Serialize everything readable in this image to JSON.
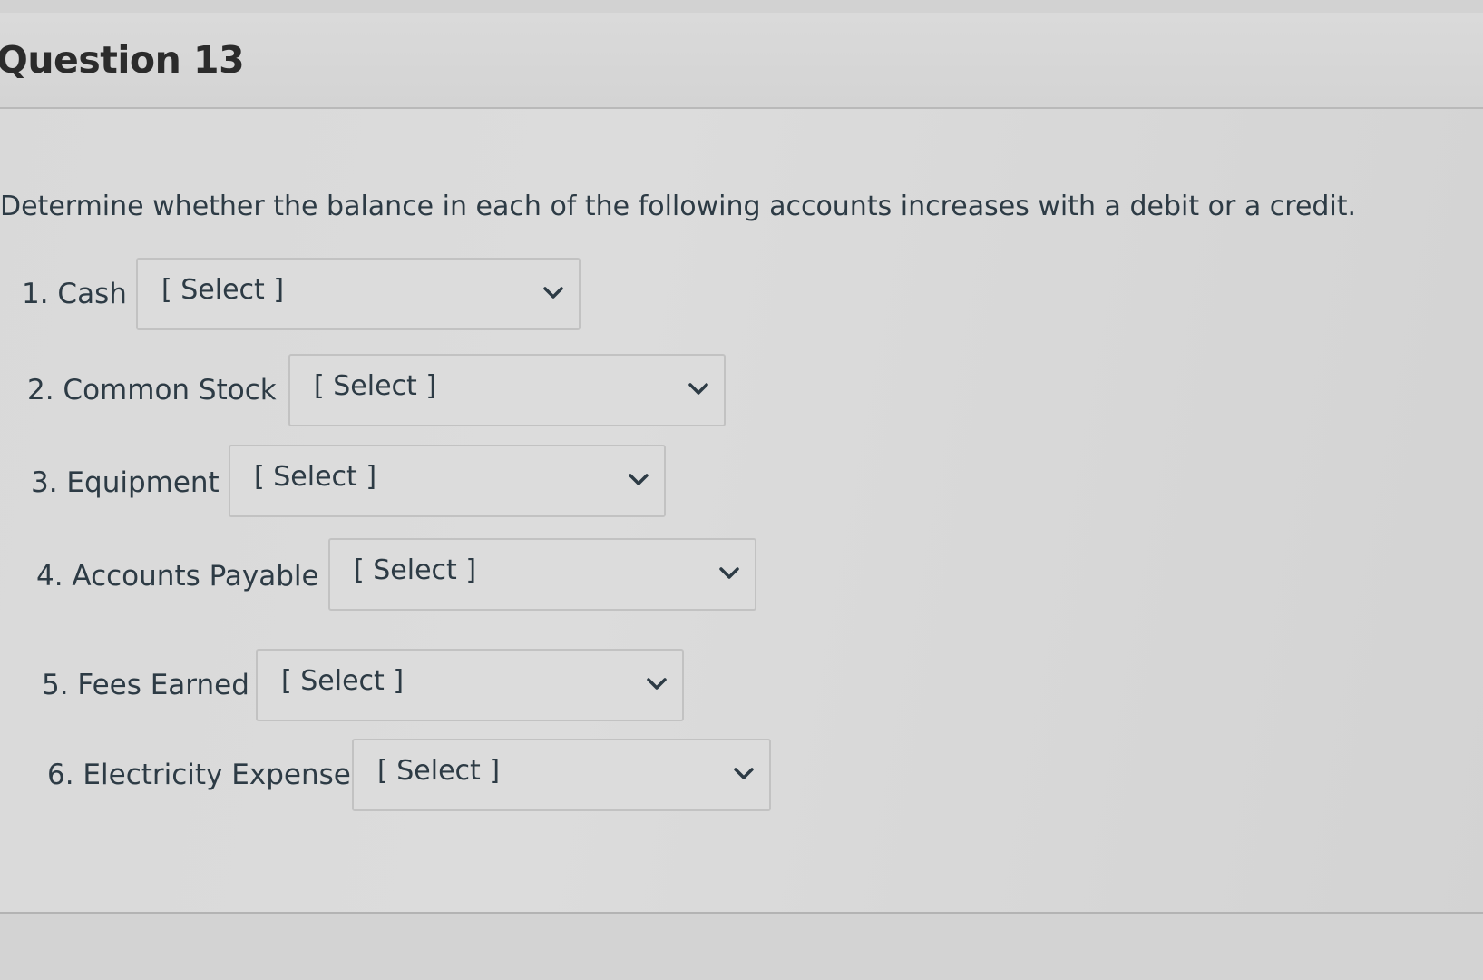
{
  "question": {
    "title": "Question 13",
    "prompt": "Determine whether the balance in each of the following accounts increases with a debit or a credit."
  },
  "items": [
    {
      "label": "1. Cash",
      "selected": "[ Select ]"
    },
    {
      "label": "2. Common Stock",
      "selected": "[ Select ]"
    },
    {
      "label": "3. Equipment",
      "selected": "[ Select ]"
    },
    {
      "label": "4. Accounts Payable",
      "selected": "[ Select ]"
    },
    {
      "label": "5. Fees Earned",
      "selected": "[ Select ]"
    },
    {
      "label": "6. Electricity Expense",
      "selected": "[ Select ]"
    }
  ],
  "icons": {
    "dropdown": "chevron-down-icon"
  },
  "colors": {
    "text": "#2d3b45",
    "background": "#d9d9d9",
    "border": "#c2c2c2"
  }
}
